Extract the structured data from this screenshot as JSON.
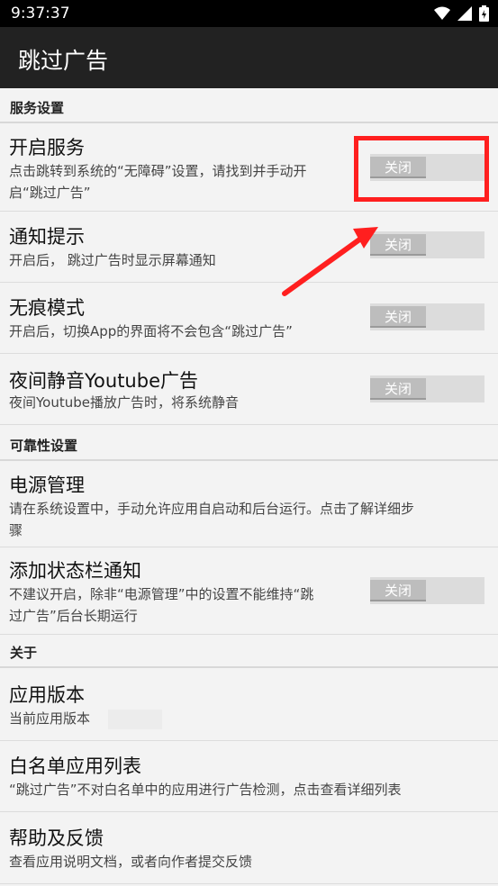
{
  "status": {
    "time": "9:37:37"
  },
  "appbar": {
    "title": "跳过广告"
  },
  "sections": [
    {
      "label": "服务设置"
    },
    {
      "label": "可靠性设置"
    },
    {
      "label": "关于"
    }
  ],
  "items": [
    {
      "title": "开启服务",
      "sub1": "点击跳转到系统的“无障碍”设置，请找到并手动开",
      "sub2": "启“跳过广告”",
      "switch": "关闭",
      "switch_on": false
    },
    {
      "title": "通知提示",
      "sub1": "开启后， 跳过广告时显示屏幕通知",
      "switch": "关闭",
      "switch_on": false
    },
    {
      "title": "无痕模式",
      "sub1": "开启后，切换App的界面将不会包含“跳过广告”",
      "switch": "关闭",
      "switch_on": false
    },
    {
      "title": "夜间静音Youtube广告",
      "sub1": "夜间Youtube播放广告时，将系统静音",
      "switch": "关闭",
      "switch_on": false
    },
    {
      "title": "电源管理",
      "sub1": "请在系统设置中，手动允许应用自启动和后台运行。点击了解详细步",
      "sub2": "骤"
    },
    {
      "title": "添加状态栏通知",
      "sub1": "不建议开启，除非“电源管理”中的设置不能维持“跳",
      "sub2": "过广告”后台长期运行",
      "switch": "关闭",
      "switch_on": false
    },
    {
      "title": "应用版本",
      "sub1": "当前应用版本"
    },
    {
      "title": "白名单应用列表",
      "sub1": "“跳过广告”不对白名单中的应用进行广告检测，点击查看详细列表"
    },
    {
      "title": "帮助及反馈",
      "sub1": "查看应用说明文档，或者向作者提交反馈"
    }
  ],
  "colors": {
    "highlight": "#ff1f1f",
    "appbar": "#222222"
  }
}
